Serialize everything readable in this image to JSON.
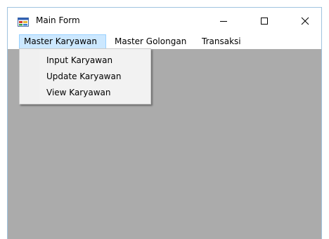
{
  "window": {
    "title": "Main Form",
    "icon": "form-app-icon",
    "controls": {
      "minimize_icon": "minimize-icon",
      "maximize_icon": "maximize-icon",
      "close_icon": "close-icon"
    }
  },
  "menubar": {
    "items": [
      {
        "label": "Master Karyawan",
        "active": true
      },
      {
        "label": "Master Golongan",
        "active": false
      },
      {
        "label": "Transaksi",
        "active": false
      }
    ]
  },
  "dropdown": {
    "items": [
      {
        "label": "Input Karyawan"
      },
      {
        "label": "Update Karyawan"
      },
      {
        "label": "View Karyawan"
      }
    ]
  },
  "colors": {
    "client_background": "#ababab",
    "menu_highlight": "#cce8ff",
    "menu_highlight_border": "#99d1ff",
    "window_border": "#9fc3df"
  }
}
